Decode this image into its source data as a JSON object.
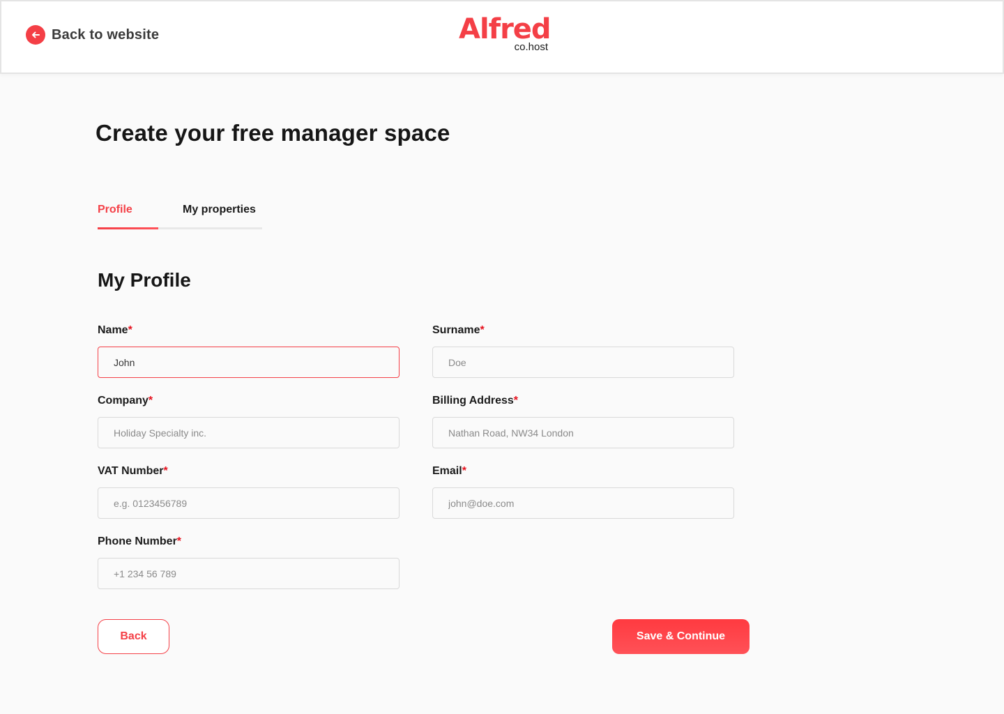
{
  "header": {
    "back_link_label": "Back to website",
    "logo": {
      "brand": "Alfred",
      "suffix": "co.host"
    }
  },
  "page_title": "Create your free manager space",
  "tabs": [
    {
      "label": "Profile",
      "active": true
    },
    {
      "label": "My properties",
      "active": false
    }
  ],
  "tab_progress_fraction": 0.37,
  "section_title": "My Profile",
  "form": {
    "required_marker": "*",
    "fields": {
      "name": {
        "label": "Name",
        "value": "John",
        "placeholder": ""
      },
      "surname": {
        "label": "Surname",
        "value": "",
        "placeholder": "Doe"
      },
      "company": {
        "label": "Company",
        "value": "",
        "placeholder": "Holiday Specialty inc."
      },
      "billing_address": {
        "label": "Billing Address",
        "value": "",
        "placeholder": "Nathan Road, NW34 London"
      },
      "vat_number": {
        "label": "VAT Number",
        "value": "",
        "placeholder": "e.g. 0123456789"
      },
      "email": {
        "label": "Email",
        "value": "",
        "placeholder": "john@doe.com"
      },
      "phone_number": {
        "label": "Phone Number",
        "value": "",
        "placeholder": "+1 234 56 789"
      }
    }
  },
  "buttons": {
    "back": "Back",
    "save_continue": "Save & Continue"
  },
  "colors": {
    "accent": "#f43f46",
    "required": "#e5101c"
  }
}
